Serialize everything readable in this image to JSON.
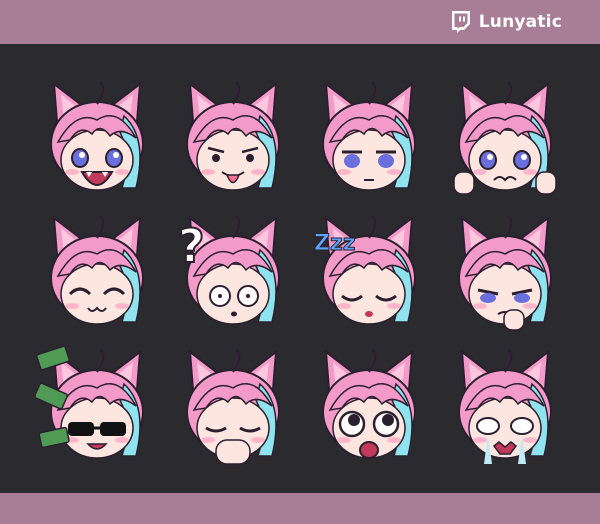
{
  "brand": {
    "name": "Lunyatic",
    "icon": "twitch-icon"
  },
  "colors": {
    "band": "#a87d96",
    "background": "#2b2a2f",
    "hair_pink": "#f49ac8",
    "hair_cyan": "#8fe3ee",
    "skin": "#fde6df",
    "eyes": "#6b6fdc"
  },
  "emotes": [
    {
      "name": "emote-yell",
      "expression": "shouting"
    },
    {
      "name": "emote-tongue",
      "expression": "tongue-out"
    },
    {
      "name": "emote-neutral",
      "expression": "neutral-stare"
    },
    {
      "name": "emote-scared",
      "expression": "scared"
    },
    {
      "name": "emote-blush-smile",
      "expression": "closed-eyes-smile"
    },
    {
      "name": "emote-confused",
      "expression": "confused",
      "glyph": "?"
    },
    {
      "name": "emote-sleep",
      "expression": "sleeping",
      "glyph": "Zzz"
    },
    {
      "name": "emote-thinking",
      "expression": "thinking"
    },
    {
      "name": "emote-money",
      "expression": "sunglasses-money"
    },
    {
      "name": "emote-giggle",
      "expression": "hand-over-mouth"
    },
    {
      "name": "emote-shocked",
      "expression": "wide-eyed-shock"
    },
    {
      "name": "emote-cry",
      "expression": "crying"
    }
  ]
}
